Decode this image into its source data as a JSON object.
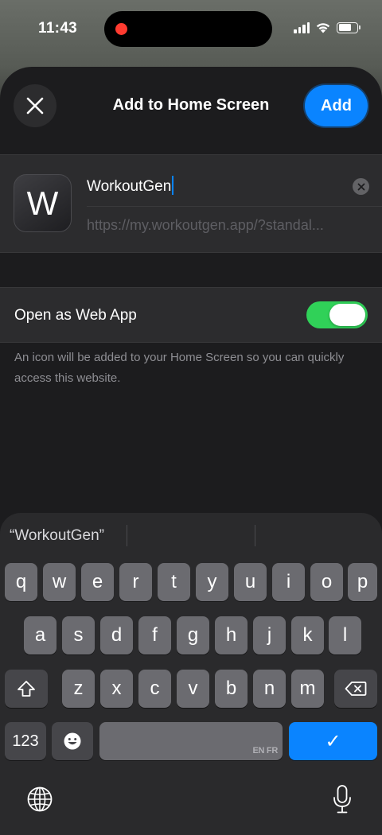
{
  "status_bar": {
    "time": "11:43"
  },
  "sheet": {
    "title": "Add to Home Screen",
    "add_label": "Add",
    "app_icon_letter": "W",
    "name_value": "WorkoutGen",
    "url": "https://my.workoutgen.app/?standal...",
    "toggle_label": "Open as Web App",
    "toggle_on": true,
    "footnote": "An icon will be added to your Home Screen so you can quickly access this website."
  },
  "keyboard": {
    "suggestion": "“WorkoutGen”",
    "row1": [
      "q",
      "w",
      "e",
      "r",
      "t",
      "y",
      "u",
      "i",
      "o",
      "p"
    ],
    "row2": [
      "a",
      "s",
      "d",
      "f",
      "g",
      "h",
      "j",
      "k",
      "l"
    ],
    "row3": [
      "z",
      "x",
      "c",
      "v",
      "b",
      "n",
      "m"
    ],
    "numbers_label": "123",
    "space_lang": "EN FR",
    "done_label": "✓"
  },
  "colors": {
    "accent": "#0a84ff",
    "toggle_on": "#30d158",
    "sheet_bg": "#1c1c1e"
  }
}
